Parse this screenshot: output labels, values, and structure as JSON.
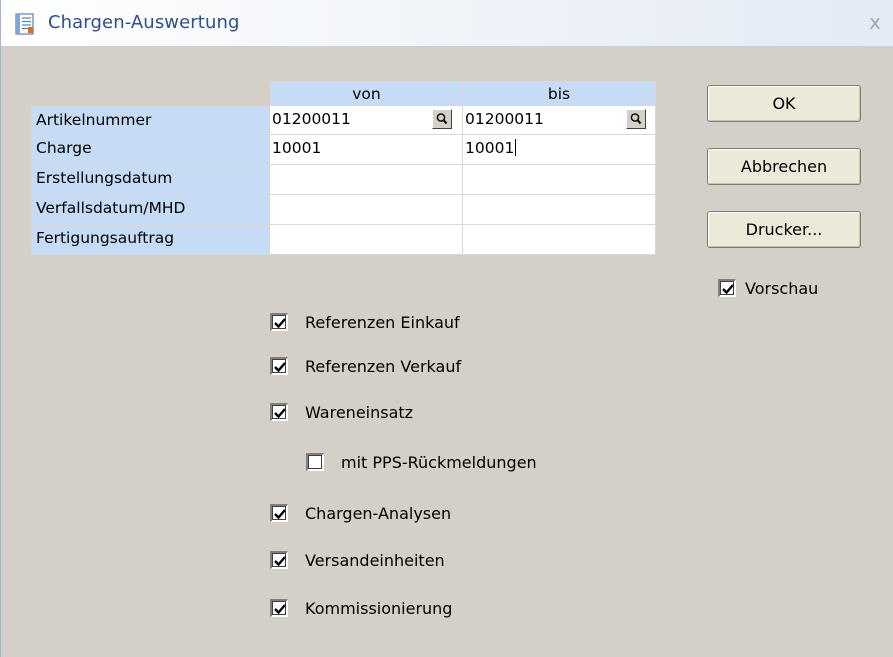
{
  "window": {
    "title": "Chargen-Auswertung",
    "close_glyph": "x"
  },
  "grid": {
    "columns": [
      "von",
      "bis"
    ],
    "rows": [
      {
        "label": "Artikelnummer",
        "von": "01200011",
        "bis": "01200011",
        "lookup": true
      },
      {
        "label": "Charge",
        "von": "10001",
        "bis": "10001",
        "lookup": false
      },
      {
        "label": "Erstellungsdatum",
        "von": "",
        "bis": "",
        "lookup": false
      },
      {
        "label": "Verfallsdatum/MHD",
        "von": "",
        "bis": "",
        "lookup": false
      },
      {
        "label": "Fertigungsauftrag",
        "von": "",
        "bis": "",
        "lookup": false
      }
    ]
  },
  "buttons": {
    "ok": "OK",
    "cancel": "Abbrechen",
    "printer": "Drucker..."
  },
  "options": {
    "preview": {
      "label": "Vorschau",
      "checked": true
    },
    "ref_purchase": {
      "label": "Referenzen Einkauf",
      "checked": true
    },
    "ref_sales": {
      "label": "Referenzen Verkauf",
      "checked": true
    },
    "goods_input": {
      "label": "Wareneinsatz",
      "checked": true
    },
    "pps_feedback": {
      "label": "mit PPS-Rückmeldungen",
      "checked": false
    },
    "batch_analyses": {
      "label": "Chargen-Analysen",
      "checked": true
    },
    "shipping_units": {
      "label": "Versandeinheiten",
      "checked": true
    },
    "picking": {
      "label": "Kommissionierung",
      "checked": true
    }
  },
  "icons": {
    "title": "report-icon",
    "lookup": "magnifier-icon",
    "check": "checkmark-icon"
  },
  "colors": {
    "grid_header": "#c6dcf6",
    "title_text": "#2f4f8a",
    "dialog_bg": "#d4d0c8"
  }
}
